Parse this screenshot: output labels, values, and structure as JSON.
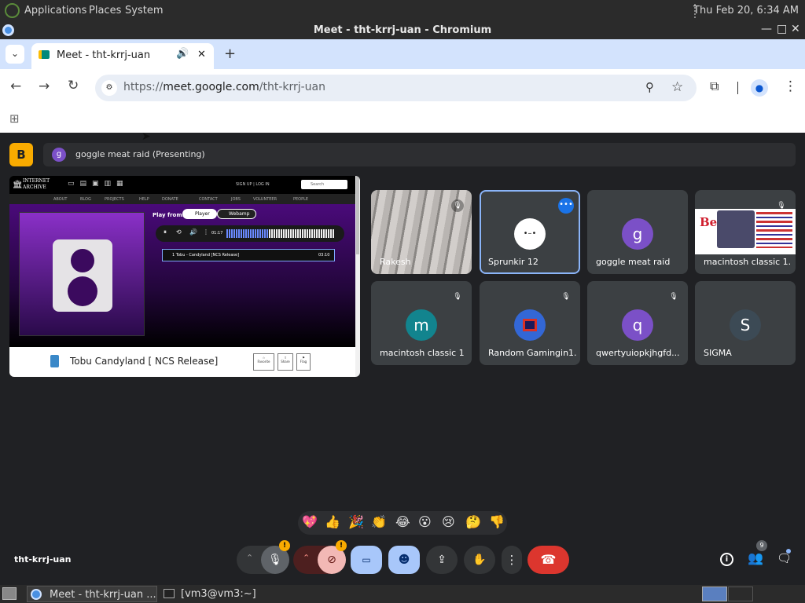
{
  "gnome": {
    "applications": "Applications",
    "places": "Places",
    "system": "System",
    "clock": "Thu Feb 20,  6:34 AM"
  },
  "window": {
    "title": "Meet - tht-krrj-uan - Chromium"
  },
  "tab": {
    "title": "Meet - tht-krrj-uan"
  },
  "omnibox": {
    "scheme": "https://",
    "host": "meet.google.com",
    "path": "/tht-krrj-uan"
  },
  "presenter": {
    "avatar_letter": "g",
    "label": "goggle meat raid (Presenting)",
    "logo_letter": "B"
  },
  "shared_screen": {
    "brand_line1": "INTERNET",
    "brand_line2": "ARCHIVE",
    "signup": "SIGN UP | LOG IN",
    "search_placeholder": "Search",
    "nav": [
      "ABOUT",
      "BLOG",
      "PROJECTS",
      "HELP",
      "DONATE",
      "CONTACT",
      "JOBS",
      "VOLUNTEER",
      "PEOPLE"
    ],
    "play_from": "Play from:",
    "player": "Player",
    "webamp": "Webamp",
    "time": "01:17",
    "track": "1   Tobu - Candyland [NCS Release]",
    "track_duration": "03:10",
    "caption": "Tobu Candyland [ NCS Release]",
    "actions": [
      "Favorite",
      "Share",
      "Flag"
    ]
  },
  "participants": [
    {
      "name": "Rakesh",
      "type": "video",
      "muted": true
    },
    {
      "name": "Sprunkir 12",
      "type": "avatar",
      "letter": "",
      "color": "#ffffff",
      "active": true,
      "muted": false
    },
    {
      "name": "goggle meat raid",
      "type": "avatar",
      "letter": "g",
      "color": "#7b50c7",
      "muted": false
    },
    {
      "name": "macintosh classic 1...",
      "type": "screen",
      "muted": true
    },
    {
      "name": "macintosh classic 1",
      "type": "avatar",
      "letter": "m",
      "color": "#12848e",
      "muted": true
    },
    {
      "name": "Random Gamingin1...",
      "type": "avatar",
      "letter": "",
      "color": "#3367d6",
      "muted": true
    },
    {
      "name": "qwertyuiopkjhgfd...",
      "type": "avatar",
      "letter": "q",
      "color": "#7b50c7",
      "muted": true
    },
    {
      "name": "SIGMA",
      "type": "avatar",
      "letter": "S",
      "color": "#3c4a55",
      "muted": false
    }
  ],
  "reactions": [
    "💖",
    "👍",
    "🎉",
    "👏",
    "😂",
    "😮",
    "😢",
    "🤔",
    "👎"
  ],
  "meeting_code": "tht-krrj-uan",
  "people_count": "9",
  "taskbar": {
    "item1": "Meet - tht-krrj-uan ...",
    "item2": "[vm3@vm3:~]"
  },
  "colors": {
    "meet_bg": "#202124",
    "end_call": "#dc362e",
    "active_btn": "#a8c7fa",
    "alert": "#f9ab00"
  }
}
